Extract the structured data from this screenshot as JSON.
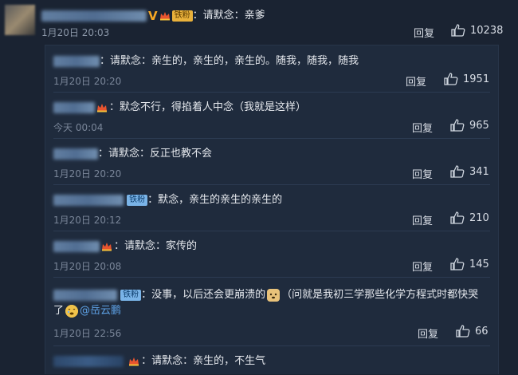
{
  "top_comment": {
    "badge_v": "V",
    "tag": "铁粉",
    "text": "：请默念：亲爹",
    "time": "1月20日 20:03",
    "reply_label": "回复",
    "likes": "10238"
  },
  "replies": [
    {
      "text": "：请默念：亲生的，亲生的，亲生的。随我，随我，随我",
      "time": "1月20日 20:20",
      "reply_label": "回复",
      "likes": "1951"
    },
    {
      "text": "：默念不行，得掐着人中念（我就是这样）",
      "time": "今天 00:04",
      "reply_label": "回复",
      "likes": "965"
    },
    {
      "text": "：请默念：反正也教不会",
      "time": "1月20日 20:20",
      "reply_label": "回复",
      "likes": "341"
    },
    {
      "tag": "铁粉",
      "text": "：默念，亲生的亲生的亲生的",
      "time": "1月20日 20:12",
      "reply_label": "回复",
      "likes": "210"
    },
    {
      "text": "：请默念：家传的",
      "time": "1月20日 20:08",
      "reply_label": "回复",
      "likes": "145"
    },
    {
      "tag": "铁粉",
      "text": "：没事，以后还会更崩溃的",
      "text_cont": "（问就是我初三学那些化学方程式时都快哭",
      "text_line2": "了",
      "mention": "@岳云鹏",
      "time": "1月20日 22:56",
      "reply_label": "回复",
      "likes": "66"
    },
    {
      "text": "：请默念：亲生的，不生气"
    }
  ]
}
